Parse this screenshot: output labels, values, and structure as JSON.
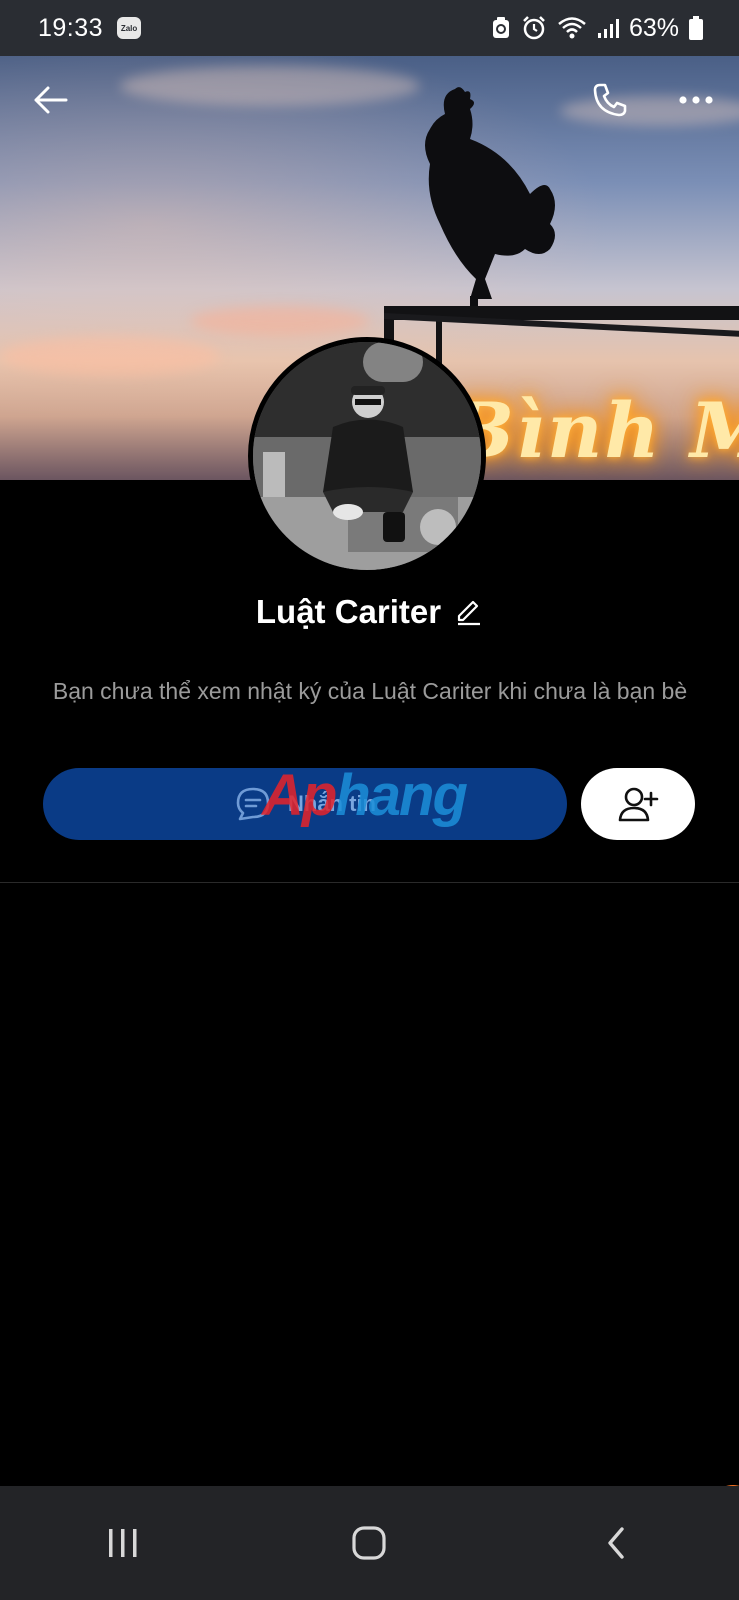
{
  "status_bar": {
    "time": "19:33",
    "app_badge": "Zalo",
    "battery": "63%",
    "icons": [
      "recycle-icon",
      "alarm-icon",
      "wifi-icon",
      "signal-icon",
      "battery-icon"
    ]
  },
  "cover": {
    "sign_text": "Bình Minh"
  },
  "profile": {
    "name": "Luật Cariter",
    "notice": "Bạn chưa thể xem nhật ký của Luật Cariter khi chưa là bạn bè"
  },
  "actions": {
    "message_label": "Nhắn tin",
    "add_friend_icon": "user-plus-icon"
  },
  "watermark": {
    "part1": "Ap",
    "part2": "hang"
  },
  "colors": {
    "message_button": "#0a3b86",
    "status_bar": "#2a2d33",
    "nav_bar": "#232427",
    "notice_text": "#9b9b9b"
  }
}
